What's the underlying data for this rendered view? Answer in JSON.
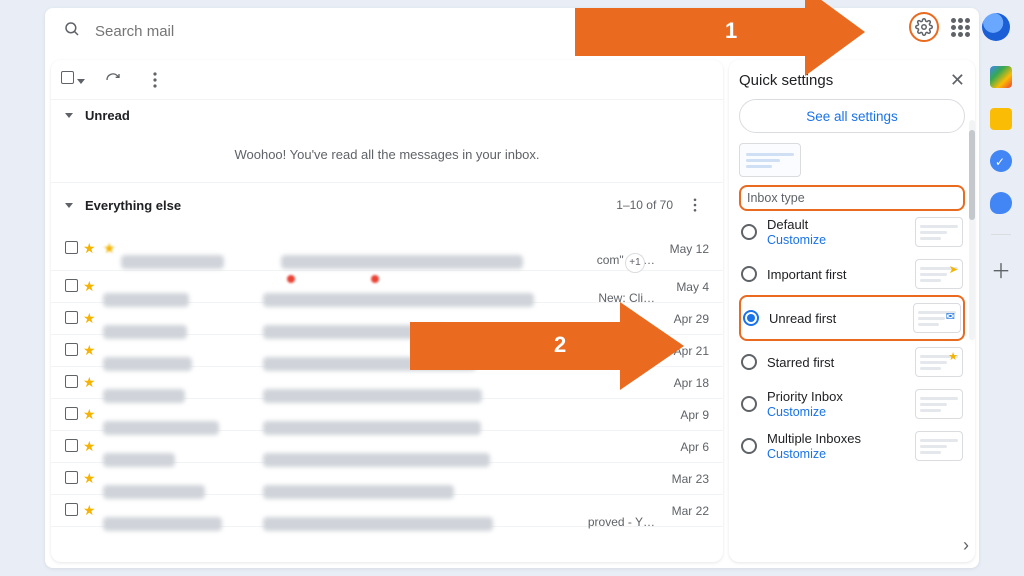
{
  "search": {
    "placeholder": "Search mail"
  },
  "sections": {
    "unread": {
      "title": "Unread",
      "empty": "Woohoo! You've read all the messages in your inbox."
    },
    "everything": {
      "title": "Everything else",
      "count": "1–10 of 70"
    }
  },
  "rows": [
    {
      "frag": "com\" - H…",
      "date": "May 12"
    },
    {
      "frag": "New: Cli…",
      "date": "May 4"
    },
    {
      "frag": "",
      "date": "Apr 29"
    },
    {
      "frag": "",
      "date": "Apr 21"
    },
    {
      "frag": "",
      "date": "Apr 18"
    },
    {
      "frag": "",
      "date": "Apr 9"
    },
    {
      "frag": "",
      "date": "Apr 6"
    },
    {
      "frag": "",
      "date": "Mar 23"
    },
    {
      "frag": "proved - Y…",
      "date": "Mar 22"
    }
  ],
  "qs": {
    "title": "Quick settings",
    "see_all": "See all settings",
    "section": "Inbox type",
    "options": [
      {
        "label": "Default",
        "customize": "Customize",
        "selected": false
      },
      {
        "label": "Important first",
        "customize": "",
        "selected": false
      },
      {
        "label": "Unread first",
        "customize": "",
        "selected": true
      },
      {
        "label": "Starred first",
        "customize": "",
        "selected": false
      },
      {
        "label": "Priority Inbox",
        "customize": "Customize",
        "selected": false
      },
      {
        "label": "Multiple Inboxes",
        "customize": "Customize",
        "selected": false
      }
    ]
  },
  "ann": {
    "n1": "1",
    "n2": "2"
  },
  "extra": {
    "plus1": "+1"
  },
  "colors": {
    "accent": "#ea6a20",
    "link": "#1a73e8"
  }
}
